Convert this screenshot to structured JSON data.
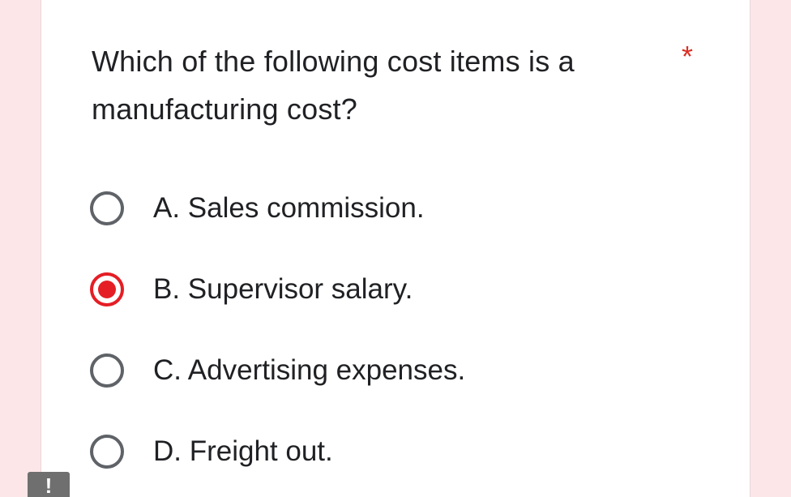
{
  "question": {
    "text": "Which of the  following cost items is a manufacturing cost?",
    "required_marker": "*"
  },
  "options": [
    {
      "label": "A.  Sales commission.",
      "selected": false
    },
    {
      "label": "B.  Supervisor salary.",
      "selected": true
    },
    {
      "label": "C.  Advertising expenses.",
      "selected": false
    },
    {
      "label": "D.  Freight out.",
      "selected": false
    }
  ],
  "alert": {
    "symbol": "!"
  },
  "colors": {
    "accent": "#e51e25",
    "required": "#d93025",
    "background": "#fde6e8",
    "text": "#202124",
    "radio_border": "#5f6368"
  }
}
